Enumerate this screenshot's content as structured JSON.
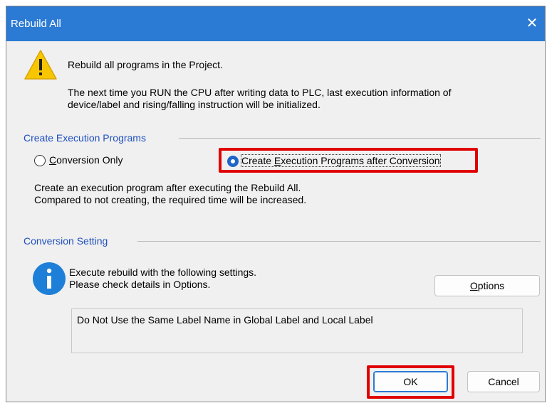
{
  "dialog": {
    "title": "Rebuild All",
    "close_icon": "close-icon"
  },
  "message": {
    "icon": "warning-icon",
    "line1": "Rebuild all programs in the Project.",
    "line2a": "The next time you RUN the CPU after writing data to PLC, last execution information of",
    "line2b": "device/label and rising/falling instruction will be initialized."
  },
  "execution_section": {
    "title": "Create Execution Programs",
    "options": [
      {
        "mnemonic": "C",
        "rest": "onversion Only",
        "selected": false
      },
      {
        "mnemonic": "E",
        "prefix": "Create ",
        "rest": "xecution Programs after Conversion",
        "selected": true
      }
    ],
    "desc1": "Create an execution program after executing the Rebuild All.",
    "desc2": "Compared to not creating, the required time will be increased."
  },
  "conversion_section": {
    "title": "Conversion Setting",
    "icon": "info-icon",
    "desc1": "Execute rebuild with the following settings.",
    "desc2": "Please check details in Options.",
    "options_button": {
      "mnemonic": "O",
      "rest": "ptions"
    },
    "settings_list": [
      "Do Not Use the Same Label Name in Global Label and Local Label"
    ]
  },
  "buttons": {
    "ok": "OK",
    "cancel": "Cancel"
  },
  "colors": {
    "titlebar": "#2b7ad4",
    "section_title": "#1f4fbf",
    "highlight": "#e00000",
    "warning_fill": "#f7c600",
    "info_fill": "#1e7fd8"
  }
}
